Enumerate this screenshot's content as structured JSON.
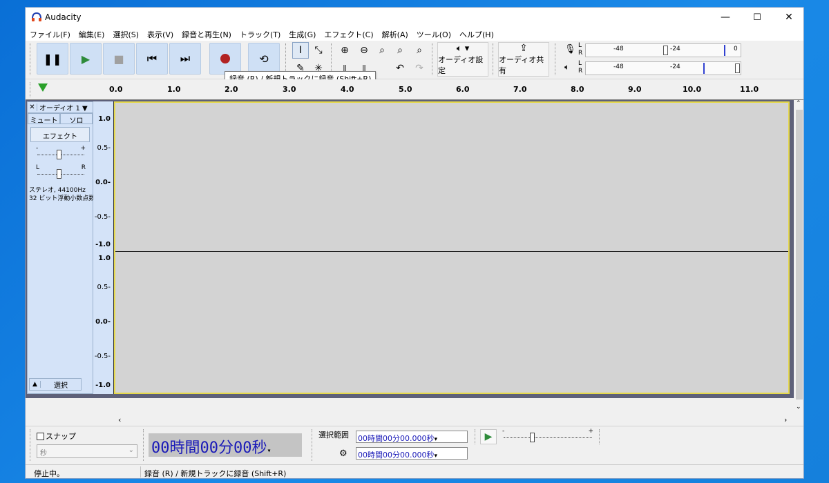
{
  "window": {
    "title": "Audacity",
    "min": "—",
    "max": "☐",
    "close": "✕"
  },
  "menu": [
    "ファイル(F)",
    "編集(E)",
    "選択(S)",
    "表示(V)",
    "録音と再生(N)",
    "トラック(T)",
    "生成(G)",
    "エフェクト(C)",
    "解析(A)",
    "ツール(O)",
    "ヘルプ(H)"
  ],
  "toolbar": {
    "audio_setup": "オーディオ設定",
    "share_audio": "オーディオ共有",
    "meter_ticks": [
      "-48",
      "-24",
      "0"
    ],
    "meter_lr": [
      "L",
      "R"
    ]
  },
  "tooltip": "録音 (R) / 新規トラックに録音 (Shift+R)",
  "ruler": [
    "0.0",
    "1.0",
    "2.0",
    "3.0",
    "4.0",
    "5.0",
    "6.0",
    "7.0",
    "8.0",
    "9.0",
    "10.0",
    "11.0"
  ],
  "track": {
    "name": "オーディオ 1",
    "mute": "ミュート",
    "solo": "ソロ",
    "effect": "エフェクト",
    "gain_minus": "-",
    "gain_plus": "+",
    "pan_l": "L",
    "pan_r": "R",
    "info1": "ステレオ, 44100Hz",
    "info2": "32 ビット浮動小数点数",
    "select": "選択",
    "scale": [
      "1.0",
      "0.5-",
      "0.0-",
      "-0.5-",
      "-1.0"
    ]
  },
  "bottom": {
    "snap": "スナップ",
    "snap_unit": "秒",
    "time": "00時間00分00秒",
    "selection_label": "選択範囲",
    "sel_start": "00時間00分00.000秒",
    "sel_end": "00時間00分00.000秒",
    "speed_minus": "-",
    "speed_plus": "+"
  },
  "status": {
    "left": "停止中。",
    "right": "録音 (R) / 新規トラックに録音 (Shift+R)"
  }
}
